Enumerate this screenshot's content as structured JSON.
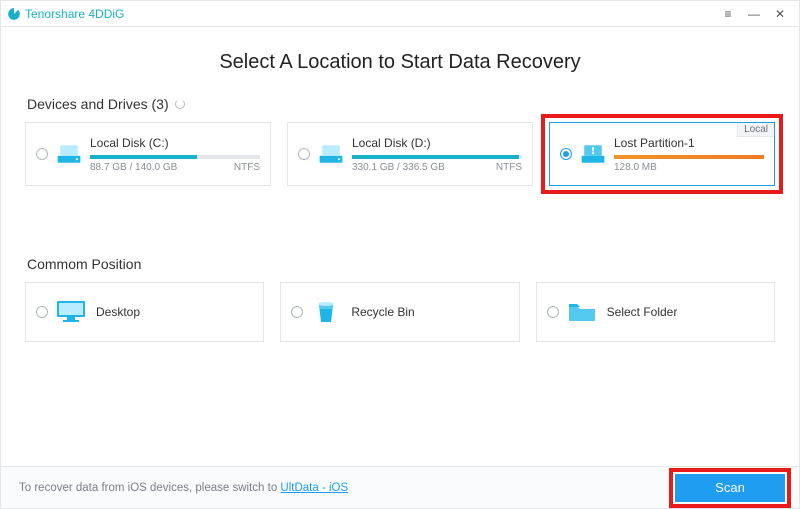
{
  "titlebar": {
    "appname": "Tenorshare 4DDiG"
  },
  "page": {
    "title": "Select A Location to Start Data Recovery"
  },
  "devices": {
    "heading": "Devices and Drives (3)",
    "items": [
      {
        "name": "Local Disk (C:)",
        "capacity": "88.7 GB / 140.0 GB",
        "fs": "NTFS",
        "fillPct": 63,
        "selected": false,
        "warn": false,
        "tag": ""
      },
      {
        "name": "Local Disk (D:)",
        "capacity": "330.1 GB / 336.5 GB",
        "fs": "NTFS",
        "fillPct": 98,
        "selected": false,
        "warn": false,
        "tag": ""
      },
      {
        "name": "Lost Partition-1",
        "capacity": "128.0 MB",
        "fs": "",
        "fillPct": 100,
        "selected": true,
        "warn": true,
        "tag": "Local"
      }
    ]
  },
  "common": {
    "heading": "Commom Position",
    "items": [
      {
        "name": "Desktop"
      },
      {
        "name": "Recycle Bin"
      },
      {
        "name": "Select Folder"
      }
    ]
  },
  "footer": {
    "text_before": "To recover data from iOS devices, please switch to ",
    "link": "UltData - iOS",
    "scan": "Scan"
  }
}
